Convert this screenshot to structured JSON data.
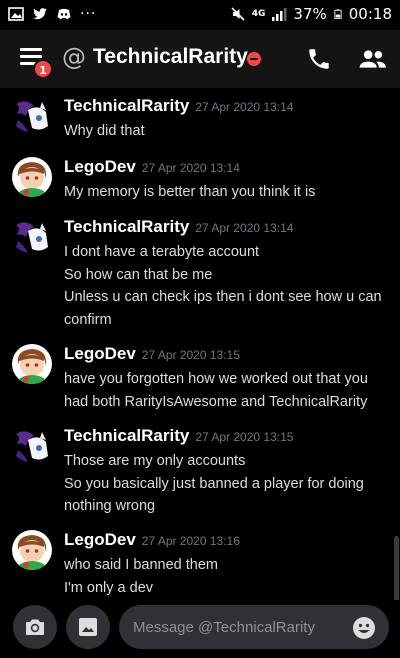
{
  "status_bar": {
    "left_icons": [
      "gallery-icon",
      "twitter-icon",
      "discord-icon"
    ],
    "more": "···",
    "network": "4G",
    "battery": "37%",
    "time": "00:18"
  },
  "header": {
    "at": "@",
    "title": "TechnicalRarity",
    "notification_count": "1",
    "status": "do-not-disturb",
    "colors": {
      "background": "#141414",
      "dnd": "#f04747",
      "badge": "#f04747"
    }
  },
  "messages": [
    {
      "author": "TechnicalRarity",
      "avatar": "rarity-avatar",
      "timestamp": "27 Apr 2020 13:14",
      "lines": [
        "Why did that"
      ]
    },
    {
      "author": "LegoDev",
      "avatar": "legodev-avatar",
      "timestamp": "27 Apr 2020 13:14",
      "lines": [
        "My memory is better than you think it is"
      ]
    },
    {
      "author": "TechnicalRarity",
      "avatar": "rarity-avatar",
      "timestamp": "27 Apr 2020 13:14",
      "lines": [
        "I dont have a terabyte account",
        "So how can that be me",
        "Unless u can check ips then i dont see how u can",
        "confirm"
      ]
    },
    {
      "author": "LegoDev",
      "avatar": "legodev-avatar",
      "timestamp": "27 Apr 2020 13:15",
      "lines": [
        "have you forgotten how we worked out that you",
        "had both RarityIsAwesome and TechnicalRarity"
      ]
    },
    {
      "author": "TechnicalRarity",
      "avatar": "rarity-avatar",
      "timestamp": "27 Apr 2020 13:15",
      "lines": [
        "Those are my only accounts",
        "So you basically just banned a player for doing",
        "nothing wrong"
      ]
    },
    {
      "author": "LegoDev",
      "avatar": "legodev-avatar",
      "timestamp": "27 Apr 2020 13:16",
      "lines": [
        "who said I banned them",
        "I'm only a dev"
      ]
    }
  ],
  "composer": {
    "placeholder": "Message @TechnicalRarity",
    "buttons": [
      "camera-icon",
      "image-icon",
      "emoji-icon"
    ]
  }
}
